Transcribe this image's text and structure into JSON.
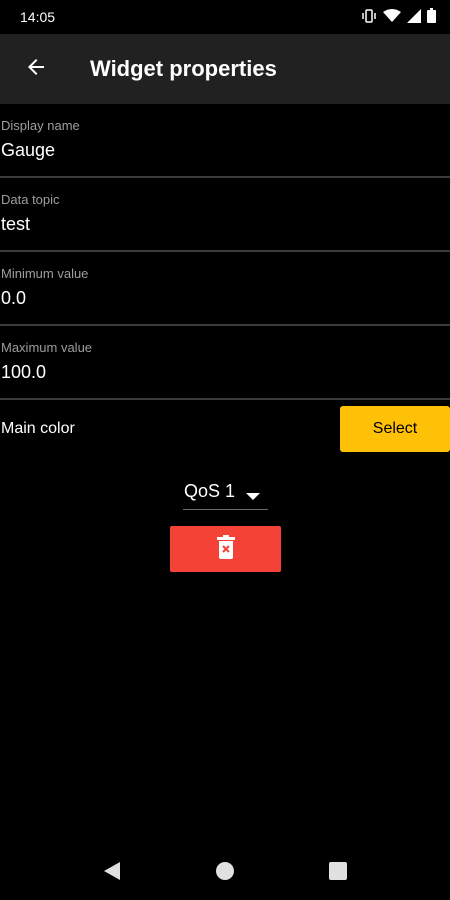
{
  "status_bar": {
    "time": "14:05",
    "icons": [
      "vibrate-icon",
      "wifi-icon",
      "signal-icon",
      "battery-icon"
    ]
  },
  "app_bar": {
    "title": "Widget properties",
    "back_icon": "arrow-back-icon"
  },
  "fields": [
    {
      "label": "Display name",
      "value": "Gauge"
    },
    {
      "label": "Data topic",
      "value": "test"
    },
    {
      "label": "Minimum value",
      "value": "0.0"
    },
    {
      "label": "Maximum value",
      "value": "100.0"
    }
  ],
  "main_color": {
    "label": "Main color",
    "button_label": "Select",
    "button_color": "#ffc107"
  },
  "qos": {
    "selected": "QoS 1"
  },
  "delete_button": {
    "icon": "delete-icon",
    "color": "#f44336"
  },
  "nav_bar": {
    "icons": [
      "back-triangle-icon",
      "home-circle-icon",
      "recents-square-icon"
    ]
  }
}
